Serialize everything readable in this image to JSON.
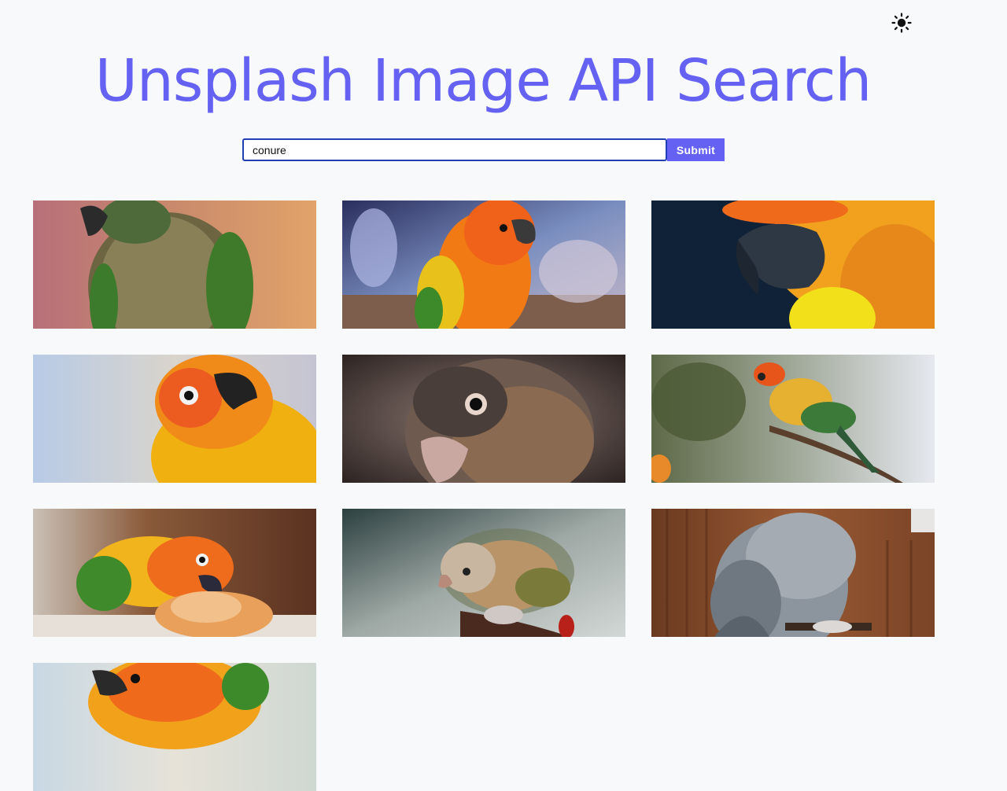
{
  "header": {
    "title": "Unsplash Image API Search",
    "theme_toggle_icon": "sun-icon"
  },
  "search": {
    "value": "conure",
    "submit_label": "Submit"
  },
  "colors": {
    "accent": "#6461f3",
    "input_border": "#1f3fb3",
    "background": "#f8f9fb"
  },
  "results": [
    {
      "subject": "green-cheeked conure on pink background"
    },
    {
      "subject": "sun conure perched, blurred blue background"
    },
    {
      "subject": "close-up of conure beak, dark background"
    },
    {
      "subject": "sun conure head, light blue background"
    },
    {
      "subject": "green-cheeked conure face close-up"
    },
    {
      "subject": "sun conure on a branch"
    },
    {
      "subject": "sun conure eating food"
    },
    {
      "subject": "pastel conure on a perch"
    },
    {
      "subject": "grey parrot perched"
    },
    {
      "subject": "sun conure close-up"
    }
  ]
}
